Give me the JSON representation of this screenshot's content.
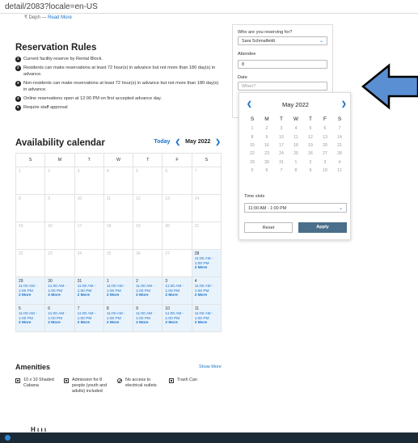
{
  "browser": {
    "url": "detail/2083?locale=en-US"
  },
  "top_cropped": {
    "text": "₹ Deph —",
    "link": "Read More"
  },
  "rules": {
    "title": "Reservation Rules",
    "items": [
      {
        "num": "1",
        "text": "Current facility reserve by Rental Block."
      },
      {
        "num": "2",
        "text": "Residents can make reservations at least 72 hour(s) in advance but not more than 180 day(s) in advance."
      },
      {
        "num": "3",
        "text": "Non-residents can make reservations at least 72 hour(s) in advance but not more than 180 day(s) in advance."
      },
      {
        "num": "4",
        "text": "Online reservations open at 12:00 PM on first accepted advance day."
      },
      {
        "num": "5",
        "text": "Require staff approval"
      }
    ]
  },
  "availability": {
    "title": "Availability calendar",
    "today": "Today",
    "month": "May 2022",
    "weekdays": [
      "S",
      "M",
      "T",
      "W",
      "T",
      "F",
      "S"
    ],
    "weeks": [
      [
        {
          "d": "1"
        },
        {
          "d": "2"
        },
        {
          "d": "3"
        },
        {
          "d": "4"
        },
        {
          "d": "5"
        },
        {
          "d": "6"
        },
        {
          "d": "7"
        }
      ],
      [
        {
          "d": "8"
        },
        {
          "d": "9"
        },
        {
          "d": "10"
        },
        {
          "d": "11"
        },
        {
          "d": "12"
        },
        {
          "d": "13"
        },
        {
          "d": "14"
        }
      ],
      [
        {
          "d": "15"
        },
        {
          "d": "16"
        },
        {
          "d": "17"
        },
        {
          "d": "18"
        },
        {
          "d": "19"
        },
        {
          "d": "20"
        },
        {
          "d": "21"
        }
      ],
      [
        {
          "d": "22"
        },
        {
          "d": "23"
        },
        {
          "d": "24"
        },
        {
          "d": "25"
        },
        {
          "d": "26"
        },
        {
          "d": "27"
        },
        {
          "d": "28",
          "slot": "11:00 AM - 1:00 PM",
          "more": "2 More"
        }
      ],
      [
        {
          "d": "29",
          "slot": "11:00 AM - 1:00 PM",
          "more": "2 More"
        },
        {
          "d": "30",
          "slot": "11:00 AM - 1:00 PM",
          "more": "2 More"
        },
        {
          "d": "31",
          "slot": "11:00 AM - 1:00 PM",
          "more": "2 More"
        },
        {
          "d": "1",
          "slot": "11:00 AM - 1:00 PM",
          "more": "2 More"
        },
        {
          "d": "2",
          "slot": "11:00 AM - 1:00 PM",
          "more": "2 More"
        },
        {
          "d": "3",
          "slot": "11:00 AM - 1:00 PM",
          "more": "2 More"
        },
        {
          "d": "4",
          "slot": "11:00 AM - 1:00 PM",
          "more": "2 More"
        }
      ],
      [
        {
          "d": "5",
          "slot": "11:00 AM - 1:00 PM",
          "more": "2 More"
        },
        {
          "d": "6",
          "slot": "11:00 AM - 1:00 PM",
          "more": "2 More"
        },
        {
          "d": "7",
          "slot": "11:00 AM - 1:00 PM",
          "more": "2 More"
        },
        {
          "d": "8",
          "slot": "11:00 AM - 1:00 PM",
          "more": "2 More"
        },
        {
          "d": "9",
          "slot": "11:00 AM - 1:00 PM",
          "more": "2 More"
        },
        {
          "d": "10",
          "slot": "11:00 AM - 1:00 PM",
          "more": "2 More"
        },
        {
          "d": "11",
          "slot": "11:00 AM - 1:00 PM",
          "more": "2 More"
        }
      ]
    ]
  },
  "amenities": {
    "title": "Amenities",
    "show_more": "Show More",
    "items": [
      {
        "icon": "square-icon",
        "text": "10 x 10 Shaded Cabana"
      },
      {
        "icon": "square-icon",
        "text": "Admission for 8 people (youth and adults) included"
      },
      {
        "icon": "no-icon",
        "text": "No access to electrical outlets"
      },
      {
        "icon": "square-icon",
        "text": "Trash Can"
      }
    ]
  },
  "reservation_form": {
    "reserving_label": "Who are you reserving for?",
    "reserving_value": "Sara Schmalfeldt",
    "attendee_label": "Attendee",
    "attendee_value": "8",
    "date_label": "Date",
    "date_placeholder": "When?"
  },
  "datepicker": {
    "month": "May 2022",
    "weekdays": [
      "S",
      "M",
      "T",
      "W",
      "T",
      "F",
      "S"
    ],
    "weeks": [
      [
        "1",
        "2",
        "3",
        "4",
        "5",
        "6",
        "7"
      ],
      [
        "8",
        "9",
        "10",
        "11",
        "12",
        "13",
        "14"
      ],
      [
        "15",
        "16",
        "17",
        "18",
        "19",
        "20",
        "21"
      ],
      [
        "22",
        "23",
        "24",
        "25",
        "26",
        "27",
        "28"
      ],
      [
        "29",
        "30",
        "31",
        "1",
        "2",
        "3",
        "4"
      ],
      [
        "5",
        "6",
        "7",
        "8",
        "9",
        "10",
        "11"
      ]
    ],
    "time_slots_label": "Time slots",
    "time_slot_value": "11:00 AM - 1:00 PM",
    "reset_label": "Reset",
    "apply_label": "Apply"
  },
  "cutoff_heading": "Η ι ι ι",
  "colors": {
    "accent": "#1a73c8",
    "apply": "#4a6f8a",
    "arrow": "#5b8fd3",
    "available": "#e9f3fc"
  }
}
